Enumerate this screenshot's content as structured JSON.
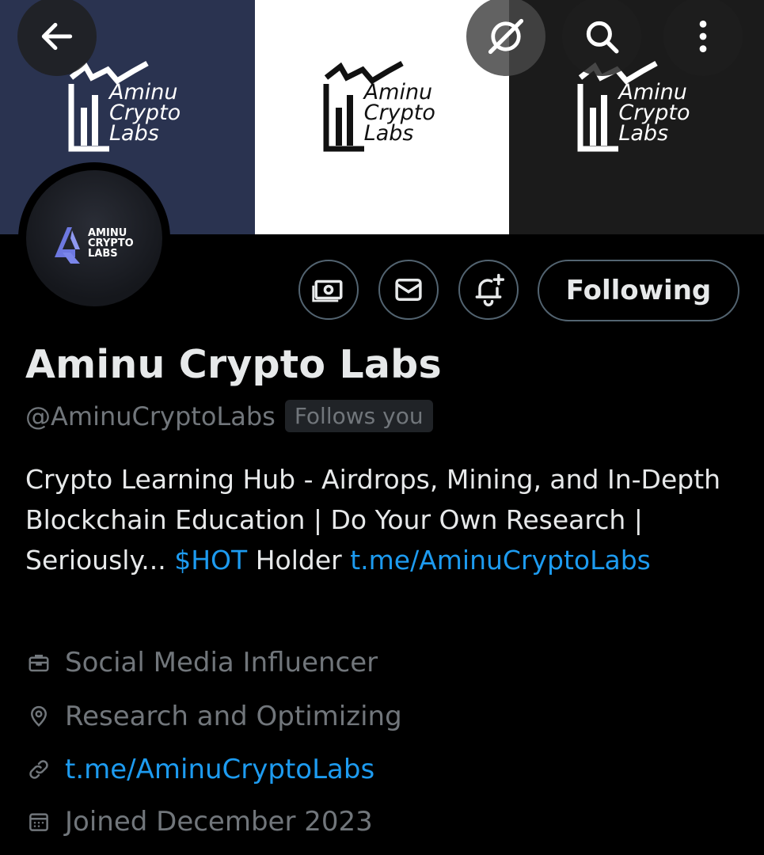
{
  "banner": {
    "logo_lines": [
      "Aminu",
      "Crypto",
      "Labs"
    ]
  },
  "header": {
    "back_icon": "arrow-left-icon",
    "grok_icon": "grok-icon",
    "search_icon": "search-icon",
    "more_icon": "more-vertical-icon"
  },
  "avatar": {
    "lines": [
      "AMINU",
      "CRYPTO",
      "LABS"
    ]
  },
  "actions": {
    "following_label": "Following"
  },
  "profile": {
    "name": "Aminu Crypto Labs",
    "handle": "@AminuCryptoLabs",
    "follows_badge": "Follows you",
    "bio_part1": "Crypto Learning Hub - Airdrops, Mining, and In-Depth Blockchain Education | Do Your Own Research | Seriously... ",
    "bio_cashtag": "$HOT",
    "bio_part2": " Holder ",
    "bio_link": "t.me/AminuCryptoLabs",
    "category": "Social Media Influencer",
    "location": "Research and Optimizing",
    "website": "t.me/AminuCryptoLabs",
    "joined": "Joined December 2023"
  },
  "colors": {
    "accent": "#1d9bf0",
    "muted": "#71767b",
    "text": "#e7e9ea"
  }
}
